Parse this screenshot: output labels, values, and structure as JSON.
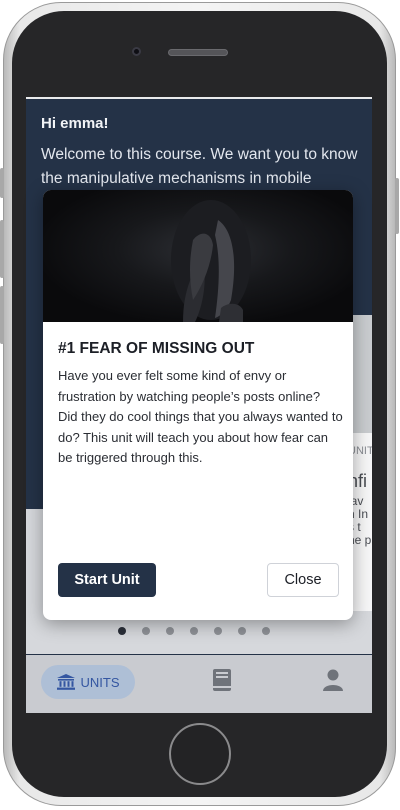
{
  "screen": {
    "greeting": "Hi emma!",
    "welcome": "Welcome to this course. We want you to know the manipulative mechanisms in mobile"
  },
  "background_card": {
    "label": "UNIT",
    "title": "nfi",
    "lines": [
      "lav",
      "n In",
      "s t",
      "ne p"
    ]
  },
  "modal": {
    "title": "#1 FEAR OF MISSING OUT",
    "body": "Have you ever felt some kind of envy or frustration by watching people’s posts online? Did they do cool things that you always wanted to do? This unit will teach you about how fear can be triggered through this.",
    "start_label": "Start Unit",
    "close_label": "Close",
    "image_icon": "person-covering-face-image"
  },
  "pagination": {
    "total": 7,
    "active": 1
  },
  "tabbar": {
    "units_label": "UNITS",
    "units_icon": "bank-icon",
    "book_icon": "book-icon",
    "profile_icon": "person-icon",
    "accent": "#3456a1"
  }
}
